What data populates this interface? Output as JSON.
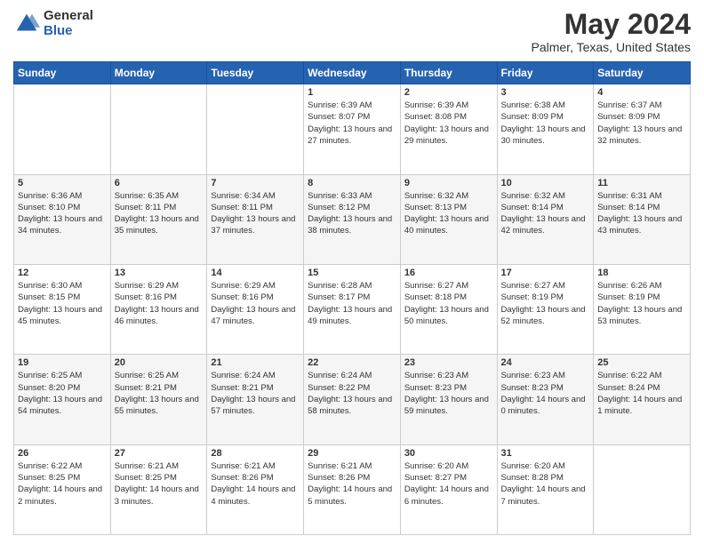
{
  "header": {
    "logo_general": "General",
    "logo_blue": "Blue",
    "title": "May 2024",
    "subtitle": "Palmer, Texas, United States"
  },
  "calendar": {
    "days_of_week": [
      "Sunday",
      "Monday",
      "Tuesday",
      "Wednesday",
      "Thursday",
      "Friday",
      "Saturday"
    ],
    "weeks": [
      [
        {
          "day": "",
          "sunrise": "",
          "sunset": "",
          "daylight": "",
          "empty": true
        },
        {
          "day": "",
          "sunrise": "",
          "sunset": "",
          "daylight": "",
          "empty": true
        },
        {
          "day": "",
          "sunrise": "",
          "sunset": "",
          "daylight": "",
          "empty": true
        },
        {
          "day": "1",
          "sunrise": "Sunrise: 6:39 AM",
          "sunset": "Sunset: 8:07 PM",
          "daylight": "Daylight: 13 hours and 27 minutes.",
          "empty": false
        },
        {
          "day": "2",
          "sunrise": "Sunrise: 6:39 AM",
          "sunset": "Sunset: 8:08 PM",
          "daylight": "Daylight: 13 hours and 29 minutes.",
          "empty": false
        },
        {
          "day": "3",
          "sunrise": "Sunrise: 6:38 AM",
          "sunset": "Sunset: 8:09 PM",
          "daylight": "Daylight: 13 hours and 30 minutes.",
          "empty": false
        },
        {
          "day": "4",
          "sunrise": "Sunrise: 6:37 AM",
          "sunset": "Sunset: 8:09 PM",
          "daylight": "Daylight: 13 hours and 32 minutes.",
          "empty": false
        }
      ],
      [
        {
          "day": "5",
          "sunrise": "Sunrise: 6:36 AM",
          "sunset": "Sunset: 8:10 PM",
          "daylight": "Daylight: 13 hours and 34 minutes.",
          "empty": false
        },
        {
          "day": "6",
          "sunrise": "Sunrise: 6:35 AM",
          "sunset": "Sunset: 8:11 PM",
          "daylight": "Daylight: 13 hours and 35 minutes.",
          "empty": false
        },
        {
          "day": "7",
          "sunrise": "Sunrise: 6:34 AM",
          "sunset": "Sunset: 8:11 PM",
          "daylight": "Daylight: 13 hours and 37 minutes.",
          "empty": false
        },
        {
          "day": "8",
          "sunrise": "Sunrise: 6:33 AM",
          "sunset": "Sunset: 8:12 PM",
          "daylight": "Daylight: 13 hours and 38 minutes.",
          "empty": false
        },
        {
          "day": "9",
          "sunrise": "Sunrise: 6:32 AM",
          "sunset": "Sunset: 8:13 PM",
          "daylight": "Daylight: 13 hours and 40 minutes.",
          "empty": false
        },
        {
          "day": "10",
          "sunrise": "Sunrise: 6:32 AM",
          "sunset": "Sunset: 8:14 PM",
          "daylight": "Daylight: 13 hours and 42 minutes.",
          "empty": false
        },
        {
          "day": "11",
          "sunrise": "Sunrise: 6:31 AM",
          "sunset": "Sunset: 8:14 PM",
          "daylight": "Daylight: 13 hours and 43 minutes.",
          "empty": false
        }
      ],
      [
        {
          "day": "12",
          "sunrise": "Sunrise: 6:30 AM",
          "sunset": "Sunset: 8:15 PM",
          "daylight": "Daylight: 13 hours and 45 minutes.",
          "empty": false
        },
        {
          "day": "13",
          "sunrise": "Sunrise: 6:29 AM",
          "sunset": "Sunset: 8:16 PM",
          "daylight": "Daylight: 13 hours and 46 minutes.",
          "empty": false
        },
        {
          "day": "14",
          "sunrise": "Sunrise: 6:29 AM",
          "sunset": "Sunset: 8:16 PM",
          "daylight": "Daylight: 13 hours and 47 minutes.",
          "empty": false
        },
        {
          "day": "15",
          "sunrise": "Sunrise: 6:28 AM",
          "sunset": "Sunset: 8:17 PM",
          "daylight": "Daylight: 13 hours and 49 minutes.",
          "empty": false
        },
        {
          "day": "16",
          "sunrise": "Sunrise: 6:27 AM",
          "sunset": "Sunset: 8:18 PM",
          "daylight": "Daylight: 13 hours and 50 minutes.",
          "empty": false
        },
        {
          "day": "17",
          "sunrise": "Sunrise: 6:27 AM",
          "sunset": "Sunset: 8:19 PM",
          "daylight": "Daylight: 13 hours and 52 minutes.",
          "empty": false
        },
        {
          "day": "18",
          "sunrise": "Sunrise: 6:26 AM",
          "sunset": "Sunset: 8:19 PM",
          "daylight": "Daylight: 13 hours and 53 minutes.",
          "empty": false
        }
      ],
      [
        {
          "day": "19",
          "sunrise": "Sunrise: 6:25 AM",
          "sunset": "Sunset: 8:20 PM",
          "daylight": "Daylight: 13 hours and 54 minutes.",
          "empty": false
        },
        {
          "day": "20",
          "sunrise": "Sunrise: 6:25 AM",
          "sunset": "Sunset: 8:21 PM",
          "daylight": "Daylight: 13 hours and 55 minutes.",
          "empty": false
        },
        {
          "day": "21",
          "sunrise": "Sunrise: 6:24 AM",
          "sunset": "Sunset: 8:21 PM",
          "daylight": "Daylight: 13 hours and 57 minutes.",
          "empty": false
        },
        {
          "day": "22",
          "sunrise": "Sunrise: 6:24 AM",
          "sunset": "Sunset: 8:22 PM",
          "daylight": "Daylight: 13 hours and 58 minutes.",
          "empty": false
        },
        {
          "day": "23",
          "sunrise": "Sunrise: 6:23 AM",
          "sunset": "Sunset: 8:23 PM",
          "daylight": "Daylight: 13 hours and 59 minutes.",
          "empty": false
        },
        {
          "day": "24",
          "sunrise": "Sunrise: 6:23 AM",
          "sunset": "Sunset: 8:23 PM",
          "daylight": "Daylight: 14 hours and 0 minutes.",
          "empty": false
        },
        {
          "day": "25",
          "sunrise": "Sunrise: 6:22 AM",
          "sunset": "Sunset: 8:24 PM",
          "daylight": "Daylight: 14 hours and 1 minute.",
          "empty": false
        }
      ],
      [
        {
          "day": "26",
          "sunrise": "Sunrise: 6:22 AM",
          "sunset": "Sunset: 8:25 PM",
          "daylight": "Daylight: 14 hours and 2 minutes.",
          "empty": false
        },
        {
          "day": "27",
          "sunrise": "Sunrise: 6:21 AM",
          "sunset": "Sunset: 8:25 PM",
          "daylight": "Daylight: 14 hours and 3 minutes.",
          "empty": false
        },
        {
          "day": "28",
          "sunrise": "Sunrise: 6:21 AM",
          "sunset": "Sunset: 8:26 PM",
          "daylight": "Daylight: 14 hours and 4 minutes.",
          "empty": false
        },
        {
          "day": "29",
          "sunrise": "Sunrise: 6:21 AM",
          "sunset": "Sunset: 8:26 PM",
          "daylight": "Daylight: 14 hours and 5 minutes.",
          "empty": false
        },
        {
          "day": "30",
          "sunrise": "Sunrise: 6:20 AM",
          "sunset": "Sunset: 8:27 PM",
          "daylight": "Daylight: 14 hours and 6 minutes.",
          "empty": false
        },
        {
          "day": "31",
          "sunrise": "Sunrise: 6:20 AM",
          "sunset": "Sunset: 8:28 PM",
          "daylight": "Daylight: 14 hours and 7 minutes.",
          "empty": false
        },
        {
          "day": "",
          "sunrise": "",
          "sunset": "",
          "daylight": "",
          "empty": true
        }
      ]
    ]
  }
}
